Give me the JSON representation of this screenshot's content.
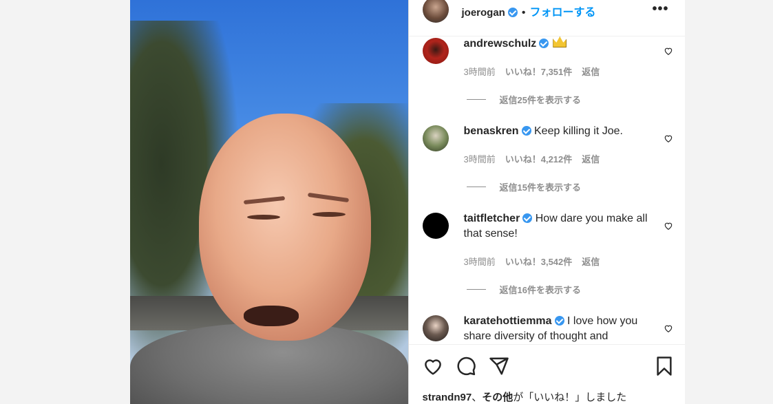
{
  "header": {
    "username": "joerogan",
    "separator": "•",
    "follow_label": "フォローする",
    "more_label": "•••"
  },
  "comments": [
    {
      "username": "andrewschulz",
      "text": "",
      "has_crown_emoji": true,
      "time": "3時間前",
      "likes": "いいね！7,351件",
      "reply": "返信",
      "view_replies": "返信25件を表示する",
      "avatar_color": "#b0241c"
    },
    {
      "username": "benaskren",
      "text": "Keep killing it Joe.",
      "time": "3時間前",
      "likes": "いいね！4,212件",
      "reply": "返信",
      "view_replies": "返信15件を表示する",
      "avatar_color": "#7a8b5c"
    },
    {
      "username": "taitfletcher",
      "text": "How dare you make all that sense!",
      "time": "3時間前",
      "likes": "いいね！3,542件",
      "reply": "返信",
      "view_replies": "返信16件を表示する",
      "avatar_color": "#000000"
    },
    {
      "username": "karatehottiemma",
      "text": "I love how you share diversity of thought and",
      "avatar_color": "#6b5a50"
    }
  ],
  "footer": {
    "liked_by_user": "strandn97",
    "liked_by_sep": "、",
    "liked_by_others": "その他",
    "liked_by_suffix": "が「いいね！」しました"
  },
  "icons": {
    "like": "heart-icon",
    "comment": "comment-icon",
    "share": "share-icon",
    "save": "bookmark-icon"
  },
  "colors": {
    "accent": "#0095f6",
    "verified": "#3897f0",
    "muted": "#8e8e8e"
  }
}
